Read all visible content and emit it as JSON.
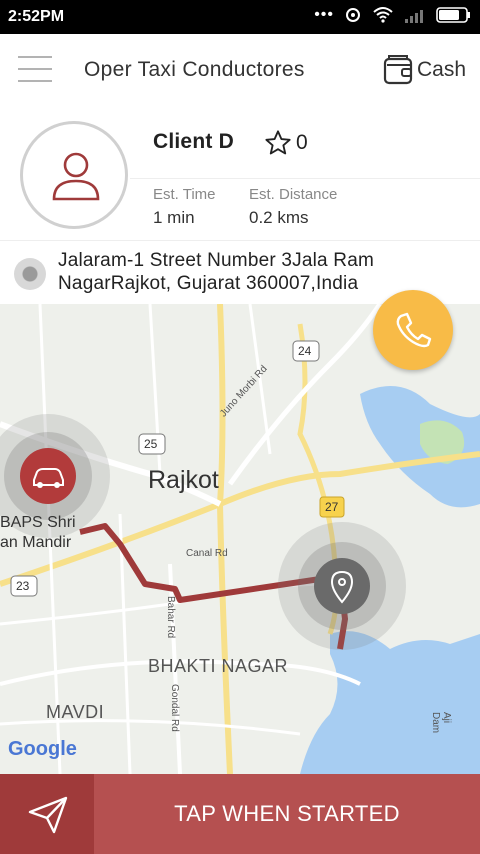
{
  "status_bar": {
    "time": "2:52PM"
  },
  "toolbar": {
    "title": "Oper Taxi Conductores",
    "payment": "Cash"
  },
  "client": {
    "name": "Client D",
    "rating": "0",
    "est_time_label": "Est. Time",
    "est_time_value": "1 min",
    "est_distance_label": "Est. Distance",
    "est_distance_value": "0.2 kms"
  },
  "address": {
    "text": "Jalaram-1 Street Number 3Jala Ram NagarRajkot, Gujarat 360007,India"
  },
  "map": {
    "city": "Rajkot",
    "area_bhakti": "BHAKTI NAGAR",
    "area_mavdi": "MAVDI",
    "place_baps_line1": "BAPS Shri",
    "place_baps_line2": "an Mandir",
    "road_juno_morbi": "Juno Morbi Rd",
    "road_canal": "Canal Rd",
    "road_lbahar": "Bahar Rd",
    "road_gondal": "Gondal Rd",
    "road_aji_dam": "Aji Dam",
    "shield_24": "24",
    "shield_25": "25",
    "shield_27": "27",
    "shield_23": "23",
    "google_logo": "Google"
  },
  "actions": {
    "start_label": "TAP WHEN STARTED"
  },
  "colors": {
    "accent": "#9f3a3a",
    "button": "#b55050",
    "call": "#f8bb47"
  }
}
